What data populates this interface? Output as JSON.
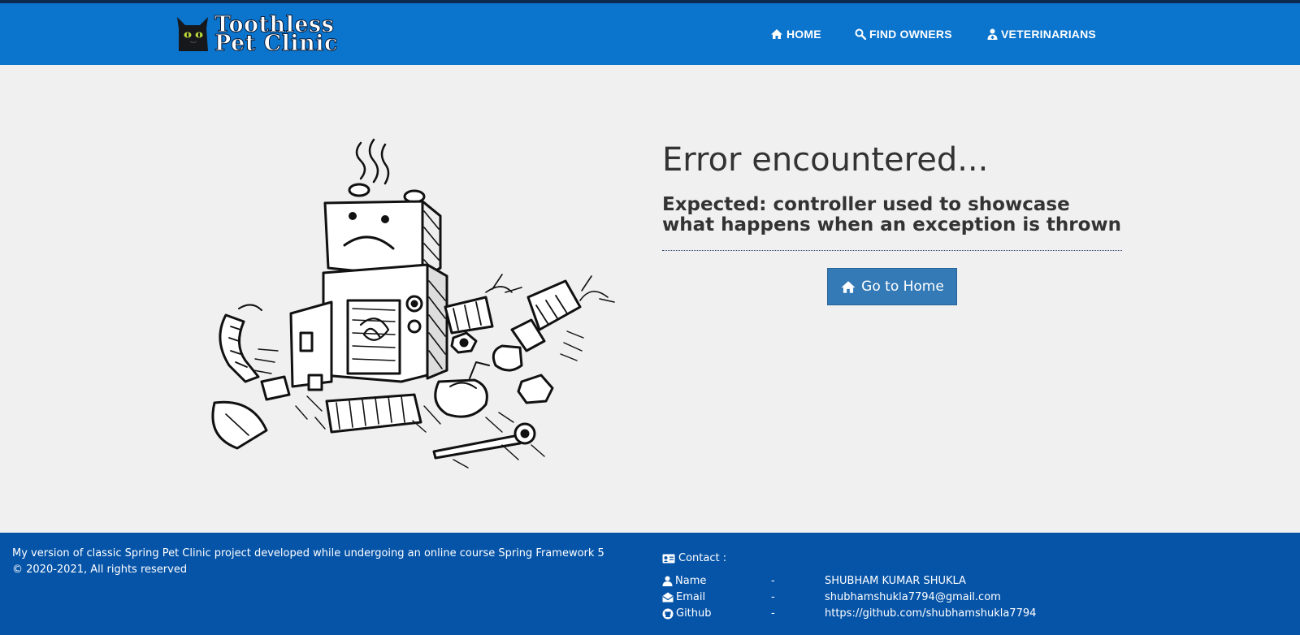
{
  "brand": {
    "line1": "Toothless",
    "line2": "Pet Clinic"
  },
  "nav": {
    "home": "HOME",
    "find_owners": "FIND OWNERS",
    "veterinarians": "VETERINARIANS"
  },
  "main": {
    "title": "Error encountered...",
    "subtitle": "Expected: controller used to showcase what happens when an exception is thrown",
    "home_button": "Go to Home"
  },
  "footer": {
    "line1": "My version of classic Spring Pet Clinic project developed while undergoing an online course Spring Framework 5",
    "line2": "© 2020-2021, All rights reserved",
    "contact_title": "Contact :",
    "rows": [
      {
        "label": "Name",
        "sep": "-",
        "value": "SHUBHAM KUMAR SHUKLA"
      },
      {
        "label": "Email",
        "sep": "-",
        "value": "shubhamshukla7794@gmail.com"
      },
      {
        "label": "Github",
        "sep": "-",
        "value": "https://github.com/shubhamshukla7794"
      }
    ]
  },
  "colors": {
    "navbar": "#0b74cc",
    "footer": "#0654a8",
    "button": "#337ab7",
    "page_bg": "#f0f0f0"
  },
  "icons": [
    "cat-logo-icon",
    "home-icon",
    "search-icon",
    "user-md-icon",
    "broken-robot-illustration",
    "id-card-icon",
    "user-icon",
    "envelope-icon",
    "github-icon"
  ]
}
